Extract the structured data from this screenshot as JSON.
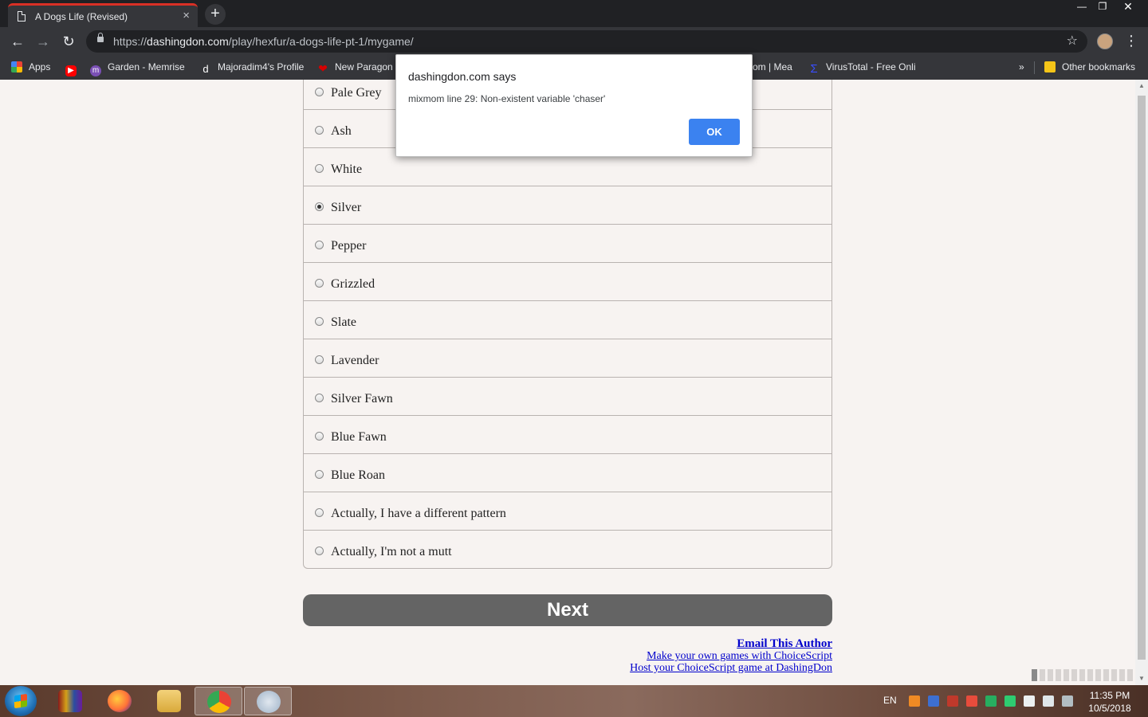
{
  "browser": {
    "tab_title": "A Dogs Life (Revised)",
    "tab_close": "×",
    "new_tab": "+",
    "url_prefix": "https://",
    "url_host": "dashingdon.com",
    "url_path": "/play/hexfur/a-dogs-life-pt-1/mygame/",
    "bookmarks": [
      {
        "label": "Apps",
        "icon": "apps-grid-icon",
        "color": "#e8453c"
      },
      {
        "label": "",
        "icon": "youtube-icon",
        "color": "#ff0000"
      },
      {
        "label": "Garden - Memrise",
        "icon": "memrise-icon",
        "color": "#7a4fb5"
      },
      {
        "label": "Majoradim4's Profile",
        "icon": "dashingdon-icon",
        "color": "#35363a"
      },
      {
        "label": "New Paragon",
        "icon": "heart-icon",
        "color": "#d50000"
      },
      {
        "label": "om | Mea",
        "icon": "",
        "color": ""
      },
      {
        "label": "VirusTotal - Free Onli",
        "icon": "virustotal-icon",
        "color": "#394eff"
      }
    ],
    "bookmarks_overflow": "»",
    "other_bookmarks": "Other bookmarks"
  },
  "options": [
    {
      "label": "Pale Grey",
      "checked": false
    },
    {
      "label": "Ash",
      "checked": false
    },
    {
      "label": "White",
      "checked": false
    },
    {
      "label": "Silver",
      "checked": true
    },
    {
      "label": "Pepper",
      "checked": false
    },
    {
      "label": "Grizzled",
      "checked": false
    },
    {
      "label": "Slate",
      "checked": false
    },
    {
      "label": "Lavender",
      "checked": false
    },
    {
      "label": "Silver Fawn",
      "checked": false
    },
    {
      "label": "Blue Fawn",
      "checked": false
    },
    {
      "label": "Blue Roan",
      "checked": false
    },
    {
      "label": "Actually, I have a different pattern",
      "checked": false
    },
    {
      "label": "Actually, I'm not a mutt",
      "checked": false
    }
  ],
  "next_button": "Next",
  "footer": {
    "email": "Email This Author",
    "make_games": "Make your own games with ChoiceScript",
    "host_game": "Host your ChoiceScript game at DashingDon"
  },
  "dialog": {
    "title": "dashingdon.com says",
    "message": "mixmom line 29: Non-existent variable 'chaser'",
    "ok": "OK"
  },
  "taskbar": {
    "language": "EN",
    "time": "11:35 PM",
    "date": "10/5/2018"
  },
  "colors": {
    "page_bg": "#f7f3f1",
    "next_button": "#646464",
    "link": "#0000cc",
    "ok_button": "#3b82f0"
  }
}
